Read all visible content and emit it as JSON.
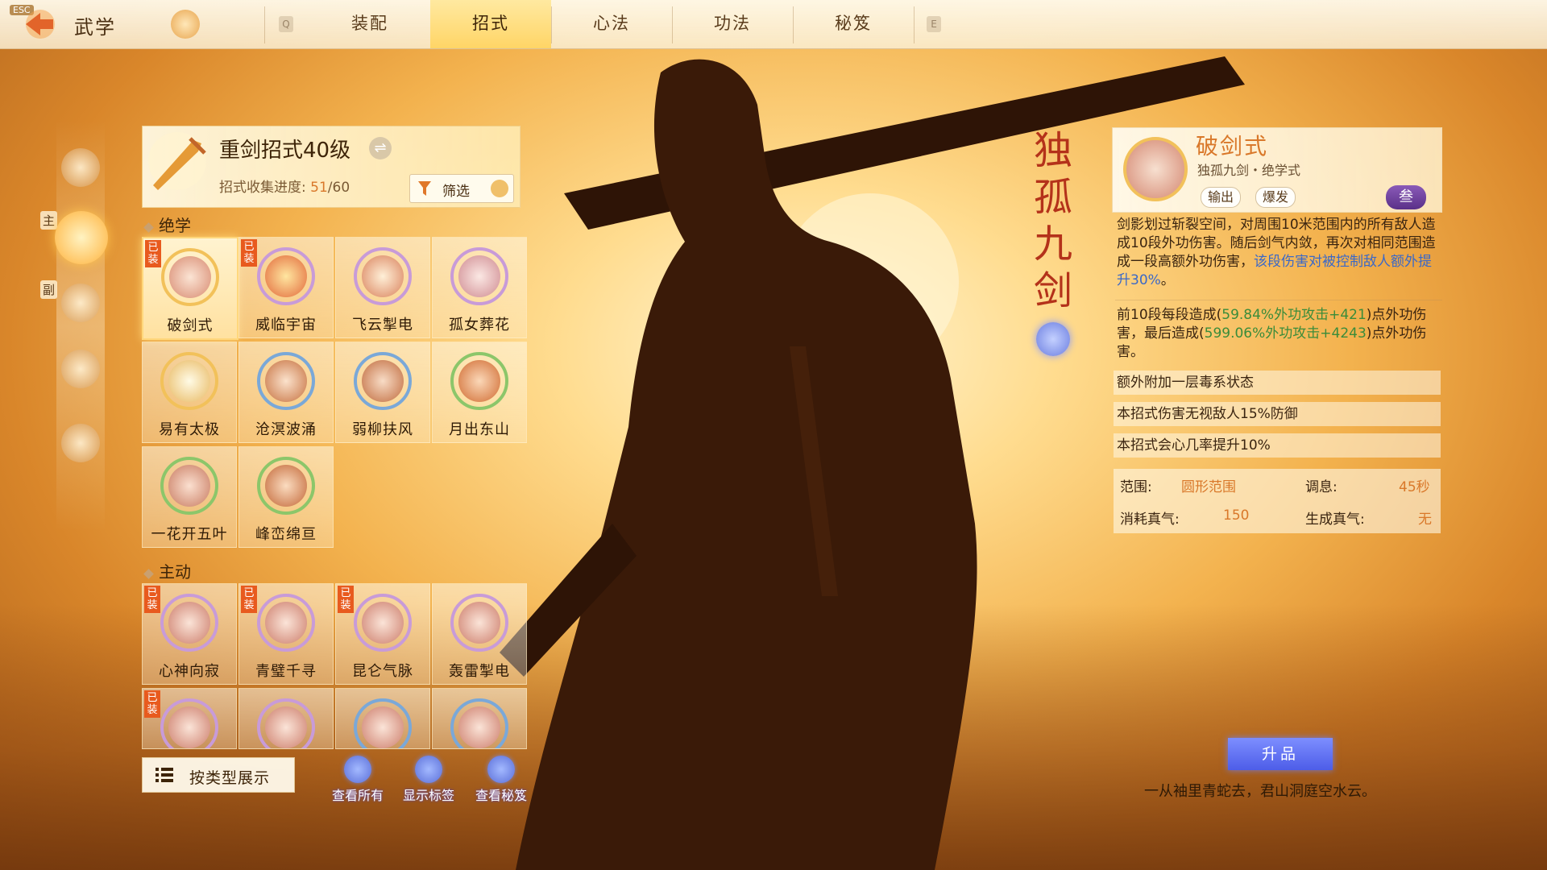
{
  "topbar": {
    "esc_label": "ESC",
    "title": "武学",
    "key_left": "Q",
    "key_right": "E",
    "tabs": [
      {
        "label": "装配",
        "active": false
      },
      {
        "label": "招式",
        "active": true
      },
      {
        "label": "心法",
        "active": false
      },
      {
        "label": "功法",
        "active": false
      },
      {
        "label": "秘笈",
        "active": false
      }
    ]
  },
  "rail": {
    "main_tag": "主",
    "sub_tag": "副"
  },
  "header": {
    "title": "重剑招式40级",
    "progress_label": "招式收集进度: ",
    "progress_current": "51",
    "progress_total": "/60",
    "filter_label": "筛选"
  },
  "sections": {
    "ultimate": "绝学",
    "active": "主动"
  },
  "badge_text": "已装",
  "ultimate_skills": [
    {
      "name": "破剑式",
      "equipped": true,
      "selected": true
    },
    {
      "name": "威临宇宙",
      "equipped": true
    },
    {
      "name": "飞云掣电",
      "equipped": false
    },
    {
      "name": "孤女葬花",
      "equipped": false
    },
    {
      "name": "易有太极",
      "equipped": false
    },
    {
      "name": "沧溟波涌",
      "equipped": false
    },
    {
      "name": "弱柳扶风",
      "equipped": false
    },
    {
      "name": "月出东山",
      "equipped": false
    },
    {
      "name": "一花开五叶",
      "equipped": false
    },
    {
      "name": "峰峦绵亘",
      "equipped": false
    }
  ],
  "active_skills": [
    {
      "name": "心神向寂",
      "equipped": true
    },
    {
      "name": "青璧千寻",
      "equipped": true
    },
    {
      "name": "昆仑气脉",
      "equipped": true
    },
    {
      "name": "轰雷掣电",
      "equipped": false
    }
  ],
  "bottom": {
    "display_mode": "按类型展示",
    "actions": [
      "查看所有",
      "显示标签",
      "查看秘笈"
    ]
  },
  "vertical_title": [
    "独",
    "孤",
    "九",
    "剑"
  ],
  "detail": {
    "name": "破剑式",
    "subtitle": "独孤九剑・绝学式",
    "tags": [
      "输出",
      "爆发"
    ],
    "rank": "叁",
    "desc_main": "剑影划过斩裂空间，对周围10米范围内的所有敌人造成10段外功伤害。随后剑气内敛，再次对相同范围造成一段高额外功伤害，",
    "desc_highlight": "该段伤害对被控制敌人额外提升30%",
    "desc_end": "。",
    "dmg_a": "前10段每段造成(",
    "dmg_a_num": "59.84%外功攻击+421",
    "dmg_b": ")点外功伤害，最后造成(",
    "dmg_b_num": "599.06%外功攻击+4243",
    "dmg_c": ")点外功伤害。",
    "effects": [
      "额外附加一层毒系状态",
      "本招式伤害无视敌人15%防御",
      "本招式会心几率提升10%"
    ],
    "stats": {
      "range_label": "范围:",
      "range_value": "圆形范围",
      "cooldown_label": "调息:",
      "cooldown_value": "45秒",
      "cost_label": "消耗真气:",
      "cost_value": "150",
      "gen_label": "生成真气:",
      "gen_value": "无"
    },
    "upgrade_label": "升品",
    "quote": "一从袖里青蛇去，君山洞庭空水云。"
  }
}
